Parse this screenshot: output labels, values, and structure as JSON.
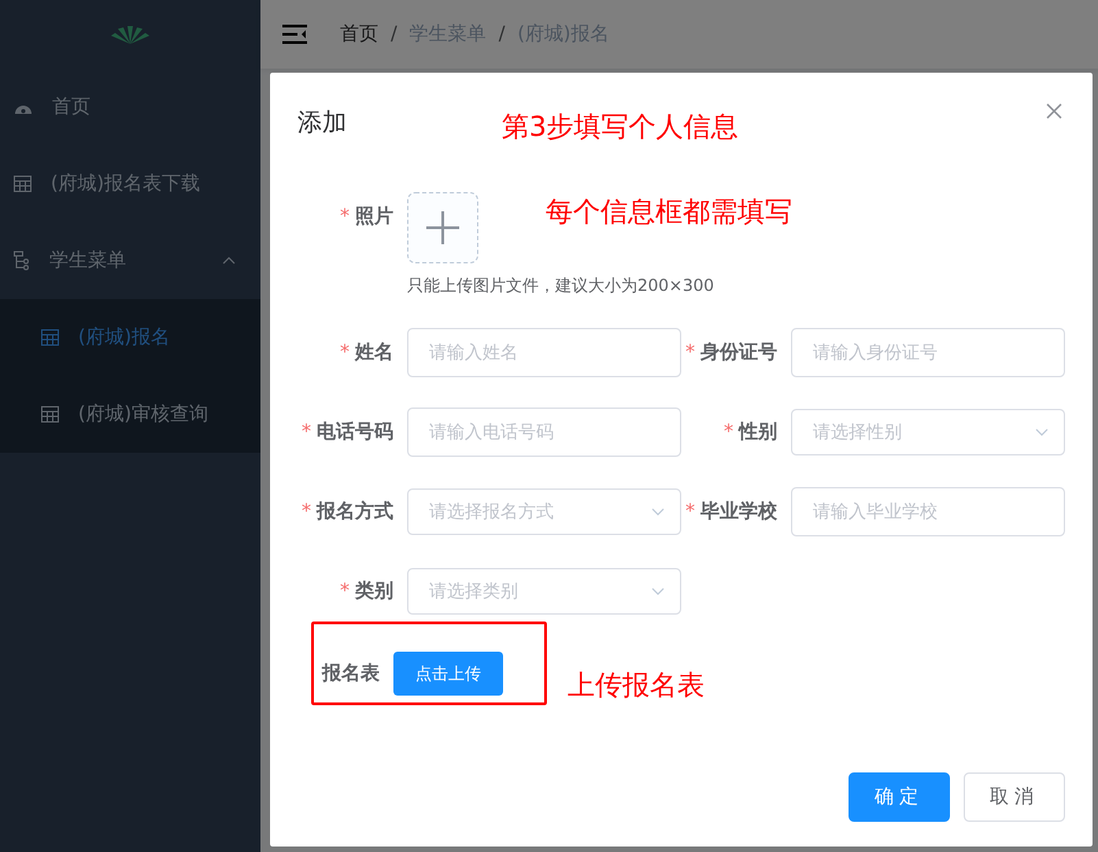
{
  "sidebar": {
    "items": [
      {
        "kind": "dashboard",
        "label": "首页",
        "selected": false
      },
      {
        "kind": "table",
        "label": "(府城)报名表下载",
        "selected": false
      },
      {
        "kind": "tree",
        "label": "学生菜单",
        "selected": false,
        "expanded": true,
        "children": [
          {
            "kind": "table",
            "label": "(府城)报名",
            "selected": true
          },
          {
            "kind": "table",
            "label": "(府城)审核查询",
            "selected": false
          }
        ]
      }
    ]
  },
  "breadcrumb": {
    "separator": "/",
    "items": [
      "首页",
      "学生菜单",
      "(府城)报名"
    ]
  },
  "dialog": {
    "title": "添加",
    "photo": {
      "label": "照片",
      "required": "*",
      "hint": "只能上传图片文件，建议大小为200×300"
    },
    "fields": [
      {
        "kind": "input",
        "label": "姓名",
        "required": "*",
        "placeholder": "请输入姓名"
      },
      {
        "kind": "input",
        "label": "身份证号",
        "required": "*",
        "placeholder": "请输入身份证号"
      },
      {
        "kind": "input",
        "label": "电话号码",
        "required": "*",
        "placeholder": "请输入电话号码"
      },
      {
        "kind": "select",
        "label": "性别",
        "required": "*",
        "placeholder": "请选择性别"
      },
      {
        "kind": "select",
        "label": "报名方式",
        "required": "*",
        "placeholder": "请选择报名方式"
      },
      {
        "kind": "input",
        "label": "毕业学校",
        "required": "*",
        "placeholder": "请输入毕业学校"
      },
      {
        "kind": "select",
        "label": "类别",
        "required": "*",
        "placeholder": "请选择类别"
      }
    ],
    "upload": {
      "label": "报名表",
      "button": "点击上传"
    },
    "buttons": [
      {
        "label": "确定",
        "primary": true
      },
      {
        "label": "取消",
        "primary": false
      }
    ]
  },
  "annotations": [
    {
      "kind": "text",
      "text": "第3步填写个人信息"
    },
    {
      "kind": "text",
      "text": "每个信息框都需填写"
    },
    {
      "kind": "box"
    },
    {
      "kind": "text",
      "text": "上传报名表"
    }
  ]
}
